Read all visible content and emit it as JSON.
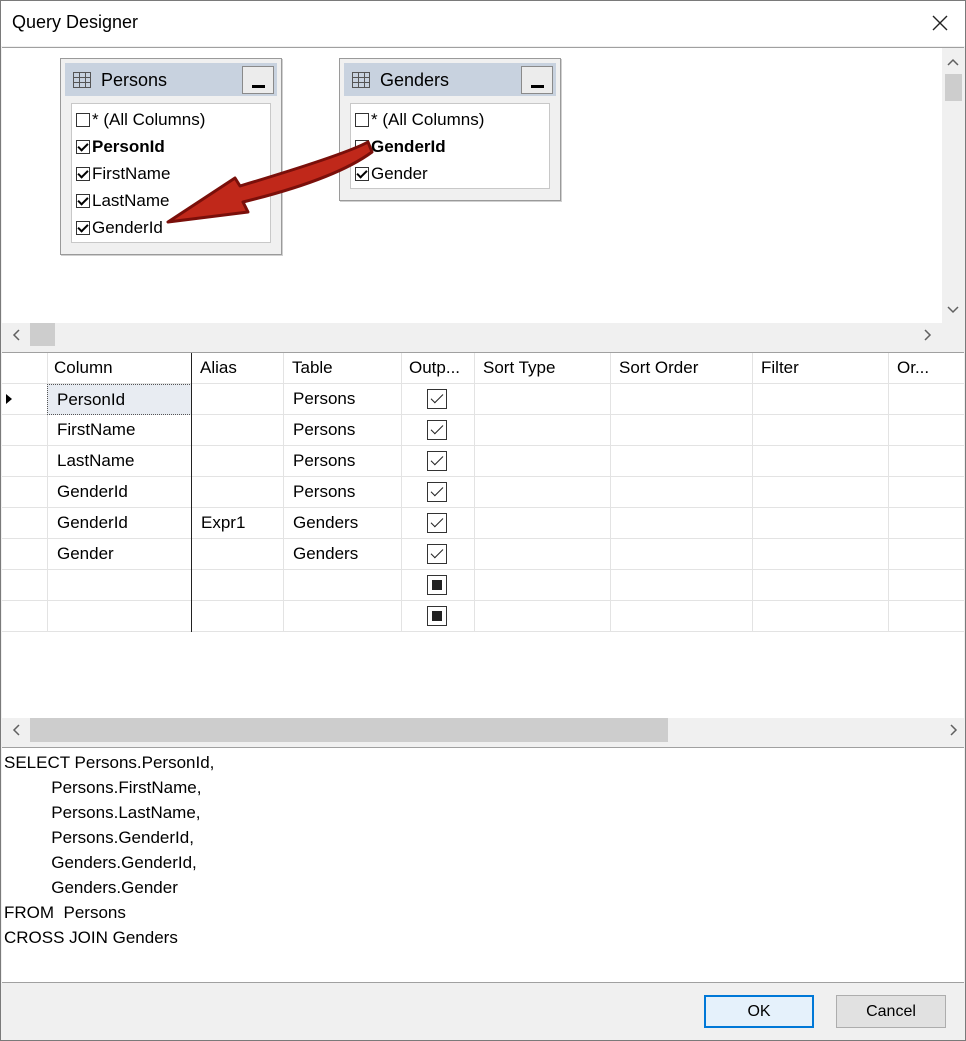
{
  "window": {
    "title": "Query Designer"
  },
  "tables": [
    {
      "name": "Persons",
      "columns": [
        {
          "label": "* (All Columns)",
          "checked": false,
          "bold": false
        },
        {
          "label": "PersonId",
          "checked": true,
          "bold": true
        },
        {
          "label": "FirstName",
          "checked": true,
          "bold": false
        },
        {
          "label": "LastName",
          "checked": true,
          "bold": false
        },
        {
          "label": "GenderId",
          "checked": true,
          "bold": false
        }
      ]
    },
    {
      "name": "Genders",
      "columns": [
        {
          "label": "* (All Columns)",
          "checked": false,
          "bold": false
        },
        {
          "label": "GenderId",
          "checked": true,
          "bold": true
        },
        {
          "label": "Gender",
          "checked": true,
          "bold": false
        }
      ]
    }
  ],
  "annotation": {
    "arrow_color": "#c0281a",
    "arrow_outline": "#7a0f0a"
  },
  "grid": {
    "headers": [
      "Column",
      "Alias",
      "Table",
      "Outp...",
      "Sort Type",
      "Sort Order",
      "Filter",
      "Or..."
    ],
    "rows": [
      {
        "column": "PersonId",
        "alias": "",
        "table": "Persons",
        "output": "checked"
      },
      {
        "column": "FirstName",
        "alias": "",
        "table": "Persons",
        "output": "checked"
      },
      {
        "column": "LastName",
        "alias": "",
        "table": "Persons",
        "output": "checked"
      },
      {
        "column": "GenderId",
        "alias": "",
        "table": "Persons",
        "output": "checked"
      },
      {
        "column": "GenderId",
        "alias": "Expr1",
        "table": "Genders",
        "output": "checked"
      },
      {
        "column": "Gender",
        "alias": "",
        "table": "Genders",
        "output": "checked"
      },
      {
        "column": "",
        "alias": "",
        "table": "",
        "output": "indeterminate"
      },
      {
        "column": "",
        "alias": "",
        "table": "",
        "output": "indeterminate"
      }
    ]
  },
  "sql": {
    "lines": [
      "SELECT Persons.PersonId,",
      "          Persons.FirstName,",
      "          Persons.LastName,",
      "          Persons.GenderId,",
      "          Genders.GenderId,",
      "          Genders.Gender",
      "FROM  Persons",
      "CROSS JOIN Genders"
    ]
  },
  "buttons": {
    "ok": "OK",
    "cancel": "Cancel"
  },
  "icons": {
    "close": "close-icon",
    "table": "table-icon",
    "minimize": "minimize-icon",
    "scroll_up": "chevron-up-icon",
    "scroll_down": "chevron-down-icon",
    "scroll_left": "chevron-left-icon",
    "scroll_right": "chevron-right-icon",
    "row_pointer": "row-pointer-icon"
  }
}
